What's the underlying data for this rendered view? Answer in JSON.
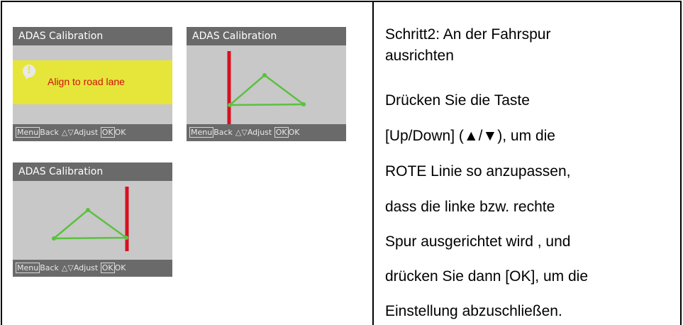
{
  "screens": [
    {
      "title": "ADAS Calibration",
      "alert_text": "Align to road lane",
      "footer": {
        "menu_key": "Menu",
        "back": "Back",
        "adjust": "Adjust",
        "ok_key": "OK",
        "ok": "OK"
      }
    },
    {
      "title": "ADAS Calibration",
      "footer": {
        "menu_key": "Menu",
        "back": "Back",
        "adjust": "Adjust",
        "ok_key": "OK",
        "ok": "OK"
      }
    },
    {
      "title": "ADAS Calibration",
      "footer": {
        "menu_key": "Menu",
        "back": "Back",
        "adjust": "Adjust",
        "ok_key": "OK",
        "ok": "OK"
      }
    }
  ],
  "instructions": {
    "step_title_line1": "Schritt2: An der Fahrspur",
    "step_title_line2": "ausrichten",
    "lines": [
      "Drücken Sie die Taste",
      "[Up/Down] (▲/▼), um die",
      "ROTE Linie so anzupassen,",
      "dass die  linke bzw. rechte",
      "Spur ausgerichtet wird  , und",
      "drücken Sie dann [OK], um die",
      "Einstellung abzuschließen."
    ]
  },
  "colors": {
    "red_line": "#d81020",
    "green_lane": "#5cc040",
    "alert_yellow": "#e6e63a",
    "bar_gray": "#6a6a6a"
  }
}
